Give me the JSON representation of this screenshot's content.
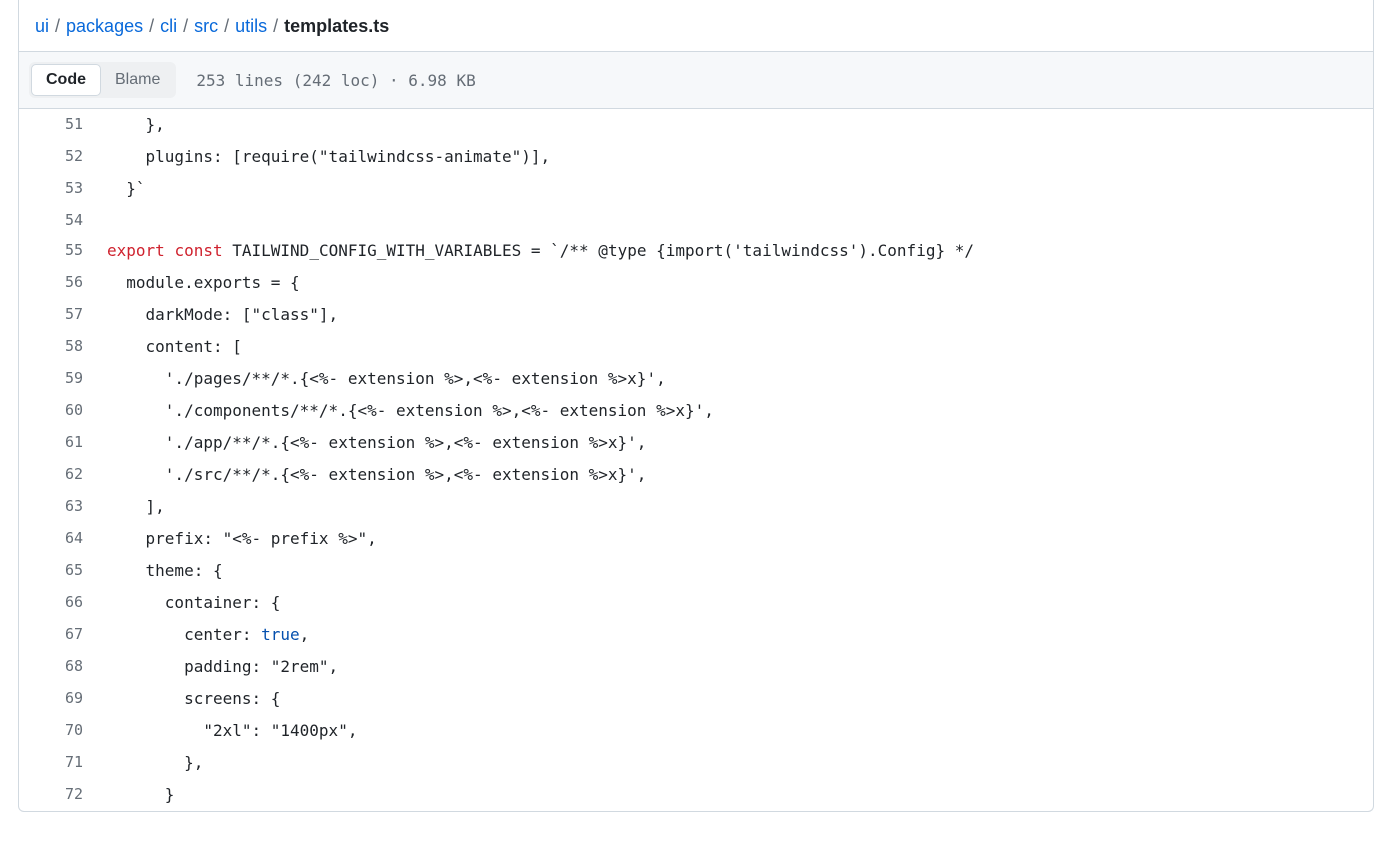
{
  "breadcrumb": {
    "items": [
      {
        "label": "ui",
        "href": true
      },
      {
        "label": "packages",
        "href": true
      },
      {
        "label": "cli",
        "href": true
      },
      {
        "label": "src",
        "href": true
      },
      {
        "label": "utils",
        "href": true
      }
    ],
    "current": "templates.ts",
    "sep": "/"
  },
  "toolbar": {
    "tabs": {
      "code": "Code",
      "blame": "Blame"
    },
    "fileinfo": "253 lines (242 loc) · 6.98 KB"
  },
  "code": {
    "tokens": {
      "export": "export",
      "const": "const",
      "identifier": "TAILWIND_CONFIG_WITH_VARIABLES",
      "true": "true"
    },
    "lines": {
      "51": "    },",
      "52": "    plugins: [require(\"tailwindcss-animate\")],",
      "53": "  }`",
      "54": "",
      "55_pre": " ",
      "55_eq": " = ",
      "55_post": "`/** @type {import('tailwindcss').Config} */",
      "56": "  module.exports = {",
      "57": "    darkMode: [\"class\"],",
      "58": "    content: [",
      "59": "      './pages/**/*.{<%- extension %>,<%- extension %>x}',",
      "60": "      './components/**/*.{<%- extension %>,<%- extension %>x}',",
      "61": "      './app/**/*.{<%- extension %>,<%- extension %>x}',",
      "62": "      './src/**/*.{<%- extension %>,<%- extension %>x}',",
      "63": "    ],",
      "64": "    prefix: \"<%- prefix %>\",",
      "65": "    theme: {",
      "66": "      container: {",
      "67_pre": "        center: ",
      "67_post": ",",
      "68": "        padding: \"2rem\",",
      "69": "        screens: {",
      "70": "          \"2xl\": \"1400px\",",
      "71": "        },",
      "72": "      }"
    },
    "line_numbers": {
      "51": "51",
      "52": "52",
      "53": "53",
      "54": "54",
      "55": "55",
      "56": "56",
      "57": "57",
      "58": "58",
      "59": "59",
      "60": "60",
      "61": "61",
      "62": "62",
      "63": "63",
      "64": "64",
      "65": "65",
      "66": "66",
      "67": "67",
      "68": "68",
      "69": "69",
      "70": "70",
      "71": "71",
      "72": "72"
    }
  }
}
